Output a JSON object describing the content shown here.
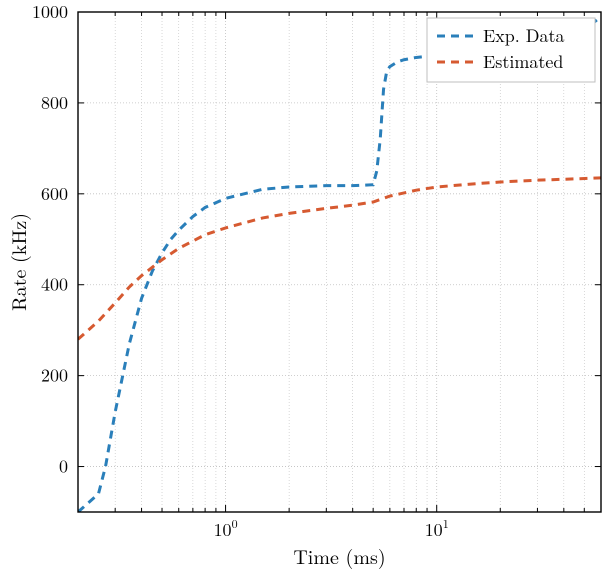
{
  "chart_data": {
    "type": "line",
    "xlabel": "Time (ms)",
    "ylabel": "Rate (kHz)",
    "title": "",
    "xlog": true,
    "xlim": [
      0.2,
      60
    ],
    "ylim": [
      -100,
      1000
    ],
    "legend_position": "upper right",
    "yticks": [
      0,
      200,
      400,
      600,
      800,
      1000
    ],
    "xticks_major": [
      1,
      10
    ],
    "series": [
      {
        "name": "Exp. Data",
        "color": "#2a7fba",
        "dash": "8,6",
        "width": 3,
        "x": [
          0.2,
          0.25,
          0.27,
          0.3,
          0.35,
          0.4,
          0.45,
          0.5,
          0.55,
          0.6,
          0.7,
          0.8,
          1.0,
          1.5,
          2.0,
          3.0,
          4.0,
          5.0,
          5.2,
          5.4,
          5.6,
          5.8,
          6.0,
          6.5,
          7.0,
          8.0,
          10.0,
          12.0,
          15,
          20,
          30,
          40,
          50,
          60
        ],
        "y": [
          -100,
          -60,
          0,
          120,
          270,
          370,
          430,
          470,
          500,
          520,
          550,
          570,
          590,
          610,
          615,
          618,
          618,
          620,
          650,
          720,
          830,
          870,
          880,
          890,
          895,
          900,
          905,
          908,
          910,
          915,
          925,
          940,
          960,
          990
        ]
      },
      {
        "name": "Estimated",
        "color": "#d65a31",
        "dash": "8,6",
        "width": 3,
        "x": [
          0.2,
          0.25,
          0.3,
          0.35,
          0.4,
          0.5,
          0.6,
          0.8,
          1.0,
          1.5,
          2.0,
          3.0,
          4.0,
          5.0,
          6.0,
          8.0,
          10,
          15,
          20,
          30,
          40,
          60
        ],
        "y": [
          280,
          320,
          360,
          395,
          420,
          455,
          480,
          510,
          525,
          547,
          557,
          568,
          575,
          582,
          595,
          608,
          615,
          622,
          626,
          630,
          632,
          635
        ]
      }
    ]
  },
  "legend": {
    "items": [
      {
        "label": "Exp. Data"
      },
      {
        "label": "Estimated"
      }
    ]
  },
  "axes": {
    "xlabel": "Time (ms)",
    "ylabel": "Rate (kHz)",
    "ytick_labels": [
      "0",
      "200",
      "400",
      "600",
      "800",
      "1000"
    ]
  }
}
